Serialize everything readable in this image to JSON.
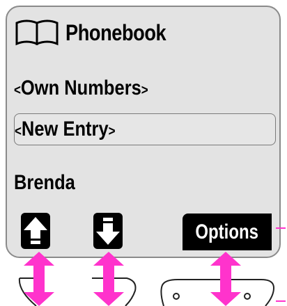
{
  "app": {
    "title": "Phonebook"
  },
  "menu": {
    "own_numbers": {
      "open": "<",
      "label": "Own Numbers",
      "close": ">"
    },
    "new_entry": {
      "open": "<",
      "label": "New Entry",
      "close": ">"
    },
    "contact": "Brenda"
  },
  "softkeys": {
    "up_icon": "arrow-up-icon",
    "down_icon": "arrow-down-icon",
    "options_label": "Options"
  },
  "colors": {
    "screen_bg": "#e3e3e3",
    "pointer": "#ff33cc",
    "softkey": "#000000"
  }
}
